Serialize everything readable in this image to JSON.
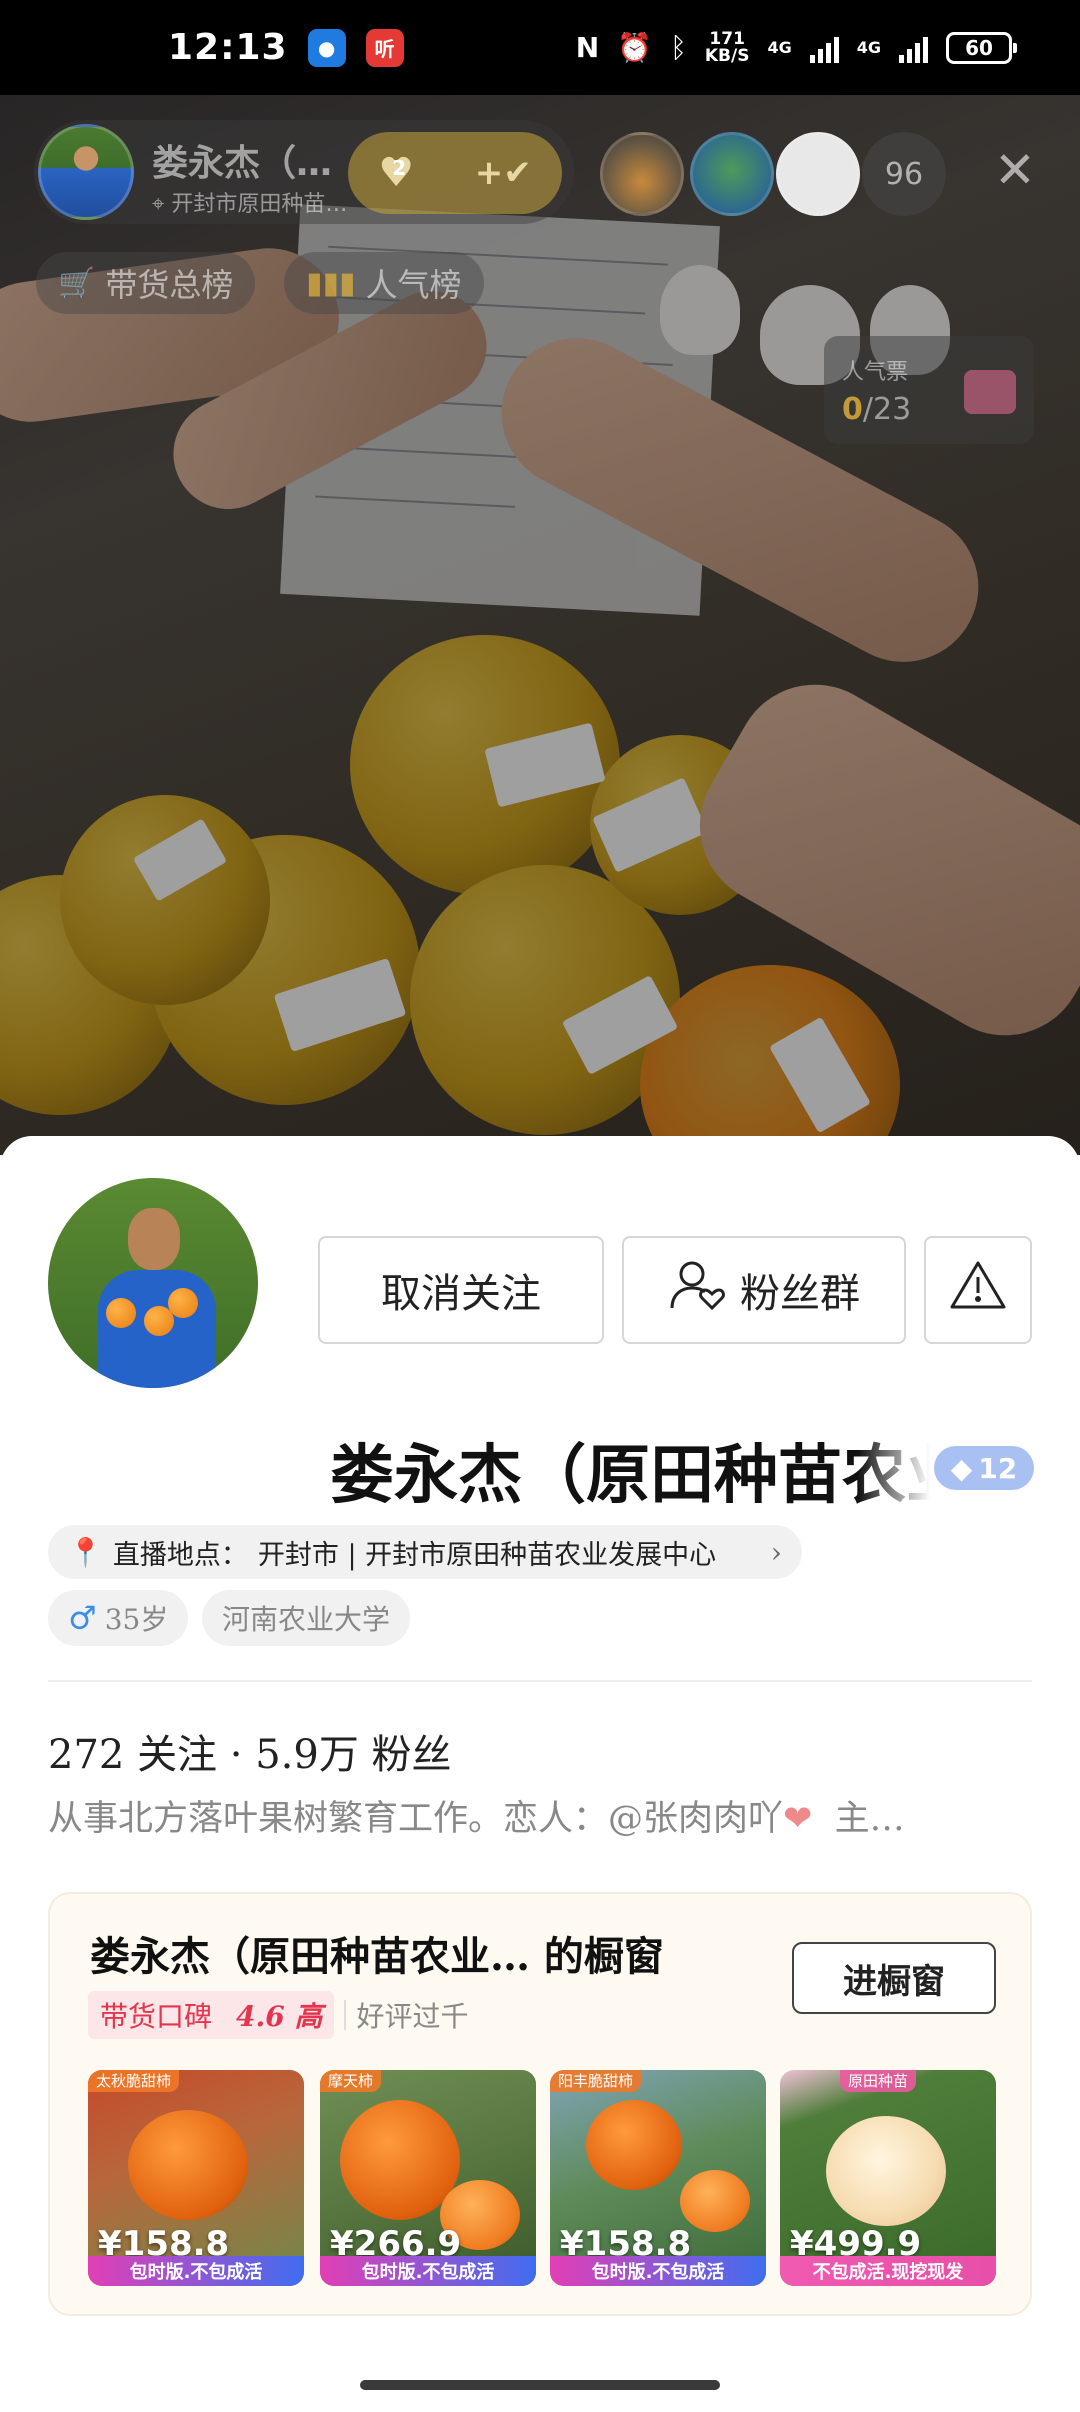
{
  "status_bar": {
    "time": "12:13",
    "app_badge_2": "听",
    "net_speed": "171",
    "net_unit": "KB/S",
    "net_type_1": "4G",
    "net_type_2": "4G",
    "battery": "60"
  },
  "live": {
    "host_name": "娄永杰（原田种苗农业",
    "host_location": "开封市原田种苗农业发展中心",
    "fan_level": "2",
    "fan_plus": "+",
    "viewer_count": "96",
    "close_icon": "close-icon",
    "rank_sales": "带货总榜",
    "rank_popular": "人气榜",
    "vote_title": "人气票",
    "vote_current": "0",
    "vote_total": "/23"
  },
  "profile": {
    "unfollow_label": "取消关注",
    "fan_group_label": "粉丝群",
    "name": "娄永杰（原田种苗农业",
    "level": "12",
    "location_prefix": "直播地点：",
    "location": "开封市 | 开封市原田种苗农业发展中心",
    "gender_age": "35岁",
    "school": "河南农业大学",
    "stats": "272 关注 · 5.9万 粉丝",
    "bio": "从事北方落叶果树繁育工作。恋人：@张肉肉吖",
    "bio_more": "主…"
  },
  "shop": {
    "title": "娄永杰（原田种苗农业…  的橱窗",
    "rating_label": "带货口碑",
    "rating_score": "4.6 高",
    "good_reviews": "好评过千",
    "enter_label": "进橱窗",
    "products": [
      {
        "price": "¥158.8",
        "ribbon": "太秋脆甜柿",
        "banner": "包时版.不包成活"
      },
      {
        "price": "¥266.9",
        "ribbon": "摩天柿",
        "banner": "包时版.不包成活"
      },
      {
        "price": "¥158.8",
        "ribbon": "阳丰脆甜柿",
        "banner": "包时版.不包成活"
      },
      {
        "price": "¥499.9",
        "ribbon": "原田种苗",
        "banner": "不包成活.现挖现发"
      }
    ]
  },
  "colors": {
    "accent_green": "#25b35c",
    "rating_red": "#e2364e",
    "level_blue": "#a9c0f2"
  }
}
